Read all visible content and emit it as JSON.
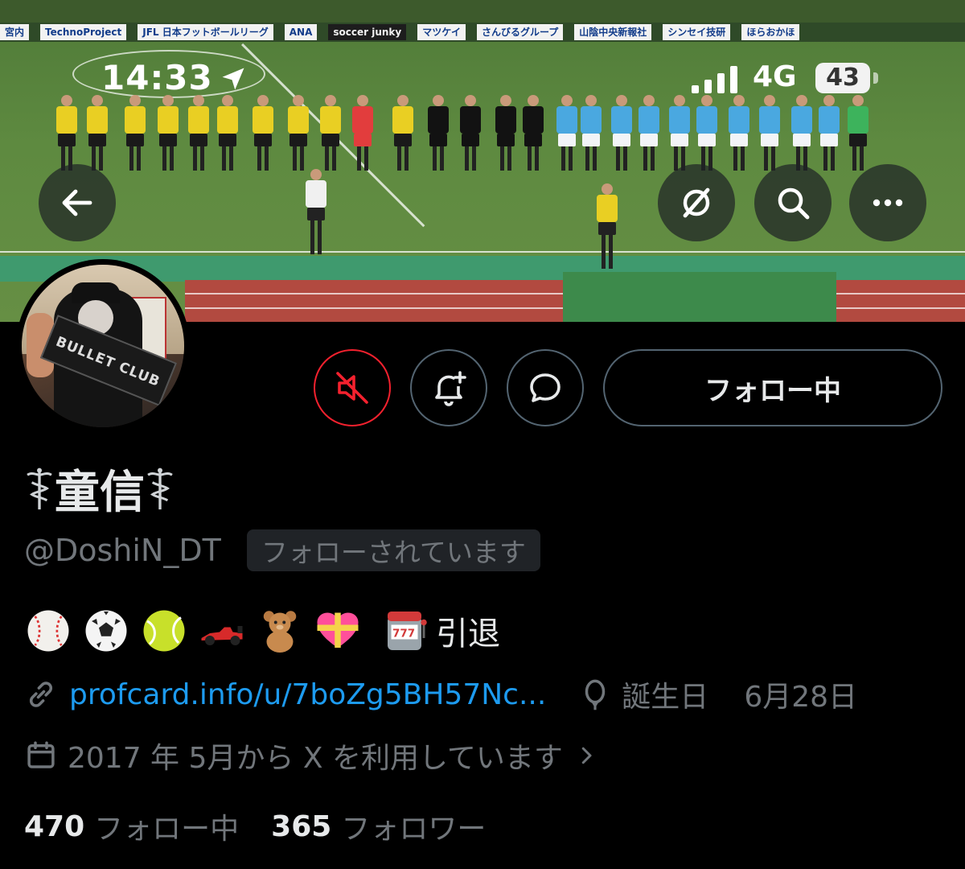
{
  "status_bar": {
    "time": "14:33",
    "network": "4G",
    "battery": "43"
  },
  "banner": {
    "ads": [
      "宮内",
      "TechnoProject",
      "JFL 日本フットボールリーグ",
      "ANA",
      "soccer junky",
      "マツケイ",
      "さんびるグループ",
      "山陰中央新報社",
      "シンセイ技研",
      "ほらおかほ"
    ]
  },
  "profile": {
    "display_name": "童信",
    "handle": "@DoshiN_DT",
    "follows_you_badge": "フォローされています",
    "follow_button_label": "フォロー中",
    "avatar_towel_text": "BULLET CLUB",
    "bio_emojis": [
      "baseball-emoji",
      "soccer-ball-emoji",
      "tennis-ball-emoji",
      "race-car-emoji",
      "teddy-bear-emoji",
      "heart-with-ribbon-emoji",
      "slot-machine-emoji"
    ],
    "bio_text": "引退",
    "link": "profcard.info/u/7boZg5BH57Nc...",
    "birthday_label": "誕生日",
    "birthday_value": "6月28日",
    "joined": "2017 年 5月から X を利用しています"
  },
  "stats": {
    "following_count": "470",
    "following_label": "フォロー中",
    "followers_count": "365",
    "followers_label": "フォロワー"
  },
  "colors": {
    "background": "#000000",
    "text_primary": "#e7e9ea",
    "text_secondary": "#71767b",
    "link": "#1d9bf0",
    "mute_red": "#f4212e",
    "border": "#536471"
  }
}
